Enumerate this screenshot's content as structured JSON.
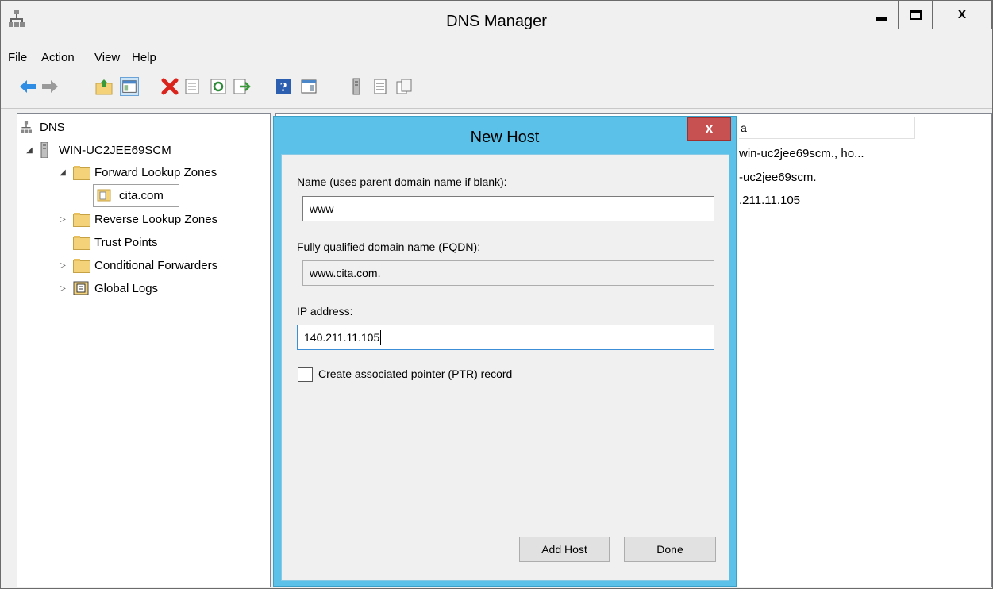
{
  "window": {
    "title": "DNS Manager",
    "close_glyph": "x"
  },
  "menu": {
    "file": "File",
    "action": "Action",
    "view": "View",
    "help": "Help"
  },
  "toolbar_icons": [
    "back-arrow-icon",
    "forward-arrow-icon",
    "up-folder-icon",
    "show-hide-tree-icon",
    "delete-icon",
    "properties-icon",
    "refresh-icon",
    "export-list-icon",
    "help-icon",
    "action-pane-icon",
    "server-icon",
    "list-icon",
    "copy-icon"
  ],
  "tree": {
    "root": "DNS",
    "server": "WIN-UC2JEE69SCM",
    "forward_zones": "Forward Lookup Zones",
    "zone": "cita.com",
    "reverse_zones": "Reverse Lookup Zones",
    "trust_points": "Trust Points",
    "conditional_forwarders": "Conditional Forwarders",
    "global_logs": "Global Logs"
  },
  "list": {
    "column_header": "a",
    "rows": [
      "win-uc2jee69scm., ho...",
      "-uc2jee69scm.",
      ".211.11.105"
    ]
  },
  "dialog": {
    "title": "New Host",
    "close_glyph": "x",
    "name_label": "Name (uses parent domain name if blank):",
    "name_value": "www",
    "fqdn_label": "Fully qualified domain name (FQDN):",
    "fqdn_value": "www.cita.com.",
    "ip_label": "IP address:",
    "ip_value": "140.211.11.105",
    "ptr_label": "Create associated pointer (PTR) record",
    "ptr_checked": false,
    "add_host_label": "Add Host",
    "done_label": "Done"
  },
  "colors": {
    "dialog_frame": "#5bc1e8",
    "dialog_close": "#c75050",
    "folder": "#f3d27a"
  }
}
